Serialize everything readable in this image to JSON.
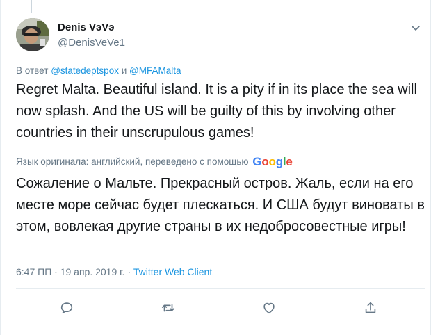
{
  "tweet": {
    "author": {
      "display_name": "Denis VэVэ",
      "screen_name": "@DenisVeVe1"
    },
    "reply_to": {
      "prefix": "В ответ",
      "handle_1": "@statedeptspox",
      "conjunction": "и",
      "handle_2": "@MFAMalta"
    },
    "text": "Regret Malta. Beautiful island. It is a pity if in its place the sea will now splash. And the US will be guilty of this by involving other countries in their unscrupulous games!",
    "translation": {
      "attribution": "Язык оригинала: английский, переведено с помощью",
      "provider": "Google",
      "text": "Сожаление о Мальте. Прекрасный остров. Жаль, если на его месте море сейчас будет плескаться. И США будут виноваты в этом, вовлекая другие страны в их недобросовестные игры!"
    },
    "meta": {
      "timestamp": "6:47 ПП · 19 апр. 2019 г.",
      "separator": "·",
      "client": "Twitter Web Client"
    }
  },
  "icons": {
    "reply": "reply-icon",
    "retweet": "retweet-icon",
    "like": "like-icon",
    "share": "share-icon",
    "caret": "chevron-down-icon"
  },
  "colors": {
    "link": "#1b95e0",
    "secondary_text": "#657786",
    "primary_text": "#14171a",
    "border": "#e6ecf0",
    "google_blue": "#4285F4",
    "google_red": "#EA4335",
    "google_yellow": "#FBBC05",
    "google_green": "#34A853"
  }
}
